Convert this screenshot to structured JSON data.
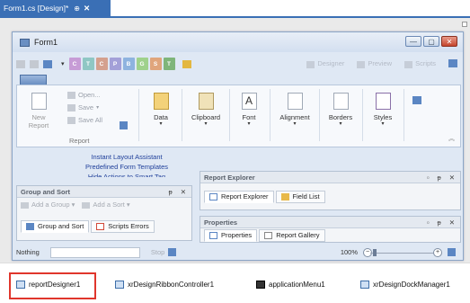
{
  "doc_tab": {
    "title": "Form1.cs [Design]*",
    "pin": "⊕",
    "close": "✕"
  },
  "form": {
    "title": "Form1",
    "window_buttons": [
      "—",
      "▢",
      "✕"
    ]
  },
  "category_tabs": [
    {
      "letter": "C",
      "color": "#c79cd6"
    },
    {
      "letter": "T",
      "color": "#8fc7c4"
    },
    {
      "letter": "C",
      "color": "#d4a08e"
    },
    {
      "letter": "P",
      "color": "#a3a0d8"
    },
    {
      "letter": "B",
      "color": "#8eb3df"
    },
    {
      "letter": "G",
      "color": "#9fd18c"
    },
    {
      "letter": "S",
      "color": "#e0a57c"
    },
    {
      "letter": "T",
      "color": "#7fb57a"
    }
  ],
  "view_tabs": {
    "designer": "Designer",
    "preview": "Preview",
    "scripts": "Scripts"
  },
  "ribbon": {
    "new_report": "New Report",
    "open": "Open...",
    "save": "Save",
    "save_all": "Save All",
    "group_report": "Report",
    "data": "Data",
    "clipboard": "Clipboard",
    "font": "Font",
    "alignment": "Alignment",
    "borders": "Borders",
    "styles": "Styles",
    "font_glyph": "A"
  },
  "smart_links": [
    "Instant Layout Assistant",
    "Predefined Form Templates",
    "Hide Actions to Smart Tag"
  ],
  "group_sort": {
    "title": "Group and Sort",
    "add_group": "Add a Group",
    "add_sort": "Add a Sort",
    "tab_group_sort": "Group and Sort",
    "tab_scripts_errors": "Scripts Errors"
  },
  "report_explorer": {
    "title": "Report Explorer",
    "tab_explorer": "Report Explorer",
    "tab_field_list": "Field List"
  },
  "properties": {
    "title": "Properties",
    "tab_properties": "Properties",
    "tab_gallery": "Report Gallery"
  },
  "panel_controls": [
    "▫",
    "ᵽ",
    "✕"
  ],
  "status": {
    "text": "Nothing",
    "stop": "Stop",
    "zoom": "100%",
    "zoom_level": 0.05
  },
  "components": [
    {
      "name": "reportDesigner1",
      "selected": true
    },
    {
      "name": "xrDesignRibbonController1",
      "selected": false
    },
    {
      "name": "applicationMenu1",
      "selected": false
    },
    {
      "name": "xrDesignDockManager1",
      "selected": false
    }
  ],
  "colors": {
    "accent": "#3a6fb5",
    "selection": "#e0362c",
    "link": "#1f3f9a"
  }
}
